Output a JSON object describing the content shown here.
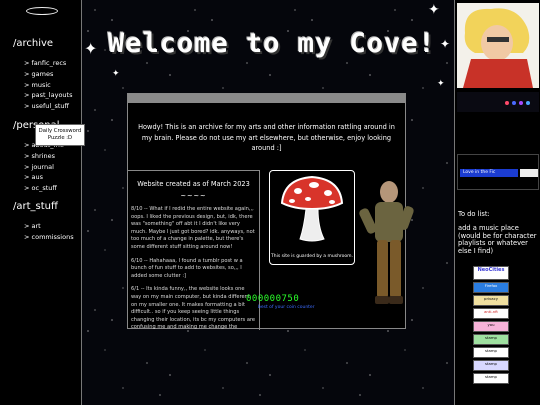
{
  "nav": {
    "archive": {
      "title": "/archive",
      "items": [
        "> fanfic_recs",
        "> games",
        "> music",
        "> past_layouts",
        "> useful_stuff"
      ]
    },
    "personal": {
      "title": "/personal",
      "items": [
        "> about_me",
        "> shrines",
        "> journal",
        "> aus",
        "> oc_stuff"
      ]
    },
    "art": {
      "title": "/art_stuff",
      "items": [
        "> art",
        "> commissions"
      ]
    }
  },
  "header": {
    "title": "Welcome to my Cove!"
  },
  "main": {
    "welcome_text": "Howdy! This is an archive for my arts and other information rattling around in my brain. Please do not use my art elsewhere, but otherwise, enjoy looking around :]",
    "created_heading": "Website created as of March 2023",
    "tilde": "~~~~",
    "updates": [
      "8/10 -- What if I redid the entire website again,,, oops. I liked the previous design, but, idk, there was \"something\" off abt it I didn't like very much. Maybe I just got bored? idk. anyways, not too much of a change in palette, but there's some different stuff sitting around now!",
      "6/10 -- Hahahaaa, I found a tumblr post w a bunch of fun stuff to add to websites, so,,, I added some clutter :]",
      "6/1 -- Its kinda funny,, the website looks one way on my main computer, but kinda different on my smaller one. It makes formatting a bit difficult.. so if you keep seeing little things changing their location, its bc my computers are confusing me and making me change the"
    ],
    "mushroom_caption": "This site is guarded by a mushroom.",
    "counter_value": "000000750",
    "counter_sub": "best of your coin counter"
  },
  "right": {
    "dots": [
      "#ff4a6a",
      "#4a6aff",
      "#a64aff",
      "#4aa6ff"
    ],
    "crossword": "Daily Crossword Puzzle :D",
    "banner_text": "Love in the Fic",
    "todo_title": "To do list:",
    "todo_items": [
      "add a music place (would be for character playlists or whatever else I find)"
    ],
    "stamps": [
      "NeoCities",
      "Firefox",
      "privacy",
      "anti-nft",
      "you",
      "stamp",
      "stamp",
      "stamp",
      "stamp"
    ]
  }
}
